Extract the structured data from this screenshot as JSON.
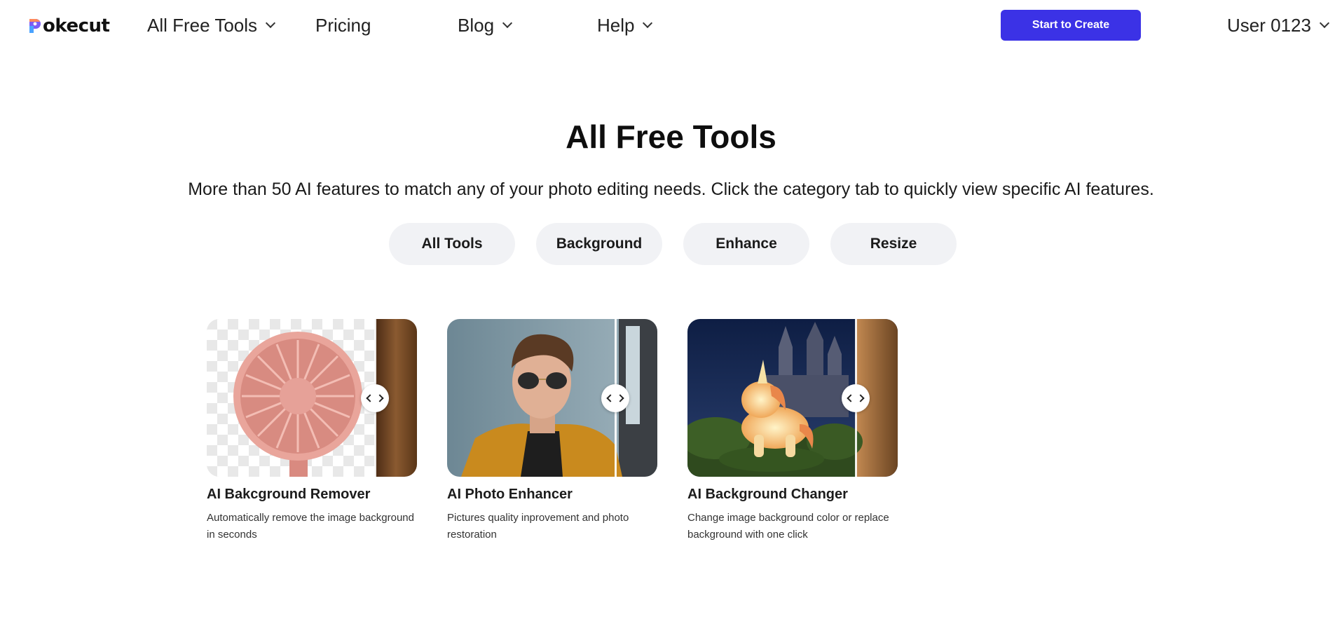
{
  "header": {
    "logo_text": "okecut",
    "logo_full": "Pokecut",
    "nav": [
      {
        "label": "All Free Tools",
        "has_dropdown": true
      },
      {
        "label": "Pricing",
        "has_dropdown": false
      },
      {
        "label": "Blog",
        "has_dropdown": true
      },
      {
        "label": "Help",
        "has_dropdown": true
      }
    ],
    "cta_label": "Start to Create",
    "user_label": "User 0123"
  },
  "hero": {
    "title": "All Free Tools",
    "subtitle": "More than 50 AI features to match any of your photo editing needs. Click the category tab to quickly view specific AI features."
  },
  "tabs": [
    {
      "label": "All Tools"
    },
    {
      "label": "Background"
    },
    {
      "label": "Enhance"
    },
    {
      "label": "Resize"
    }
  ],
  "cards": [
    {
      "title": "AI Bakcground Remover",
      "description": "Automatically remove the image background in seconds"
    },
    {
      "title": "AI Photo Enhancer",
      "description": "Pictures quality inprovement and photo restoration"
    },
    {
      "title": "AI Background Changer",
      "description": "Change image background color or replace background with one click"
    }
  ],
  "colors": {
    "accent": "#3b32e6",
    "tab_bg": "#f1f2f5"
  }
}
